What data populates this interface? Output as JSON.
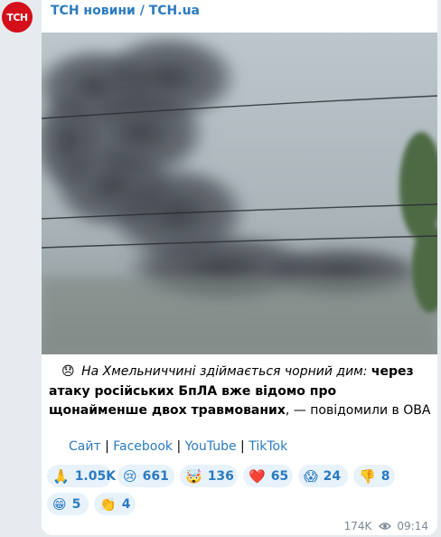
{
  "avatar": {
    "text": "ТСН"
  },
  "channel": {
    "name": "ТСН новини / ТСН.ua"
  },
  "post": {
    "emoji": "😞",
    "italic": "На Хмельниччині здіймається чорний дим",
    "colon": ":",
    "bold": "через атаку російських БпЛА вже відомо про щонайменше двох травмованих",
    "rest": ", — повідомили в ОВА"
  },
  "links": {
    "site": "Сайт",
    "facebook": "Facebook",
    "youtube": "YouTube",
    "tiktok": "TikTok",
    "sep": "|"
  },
  "reactions": [
    {
      "icon": "🙏",
      "count": "1.05K"
    },
    {
      "icon": "😢",
      "count": "661"
    },
    {
      "icon": "🤯",
      "count": "136"
    },
    {
      "icon": "❤️",
      "count": "65"
    },
    {
      "icon": "😱",
      "count": "24"
    },
    {
      "icon": "👎",
      "count": "8"
    },
    {
      "icon": "😁",
      "count": "5"
    },
    {
      "icon": "👏",
      "count": "4"
    }
  ],
  "meta": {
    "views": "174K",
    "time": "09:14"
  },
  "colors": {
    "accent": "#2b7bc0",
    "brand": "#d50f1a"
  }
}
